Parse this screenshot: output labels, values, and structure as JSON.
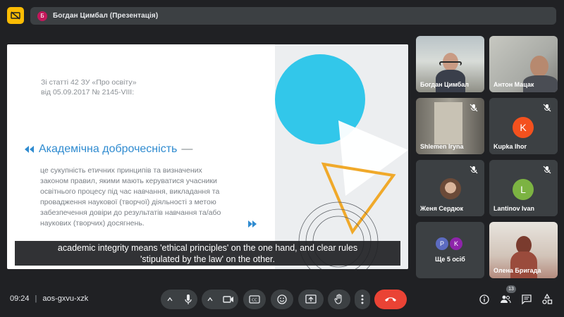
{
  "top_bar": {
    "presenter_initial": "Б",
    "presenter_label": "Богдан Цимбал (Презентація)"
  },
  "slide": {
    "source_line1": "Зі статті 42 ЗУ «Про освіту»",
    "source_line2": "від 05.09.2017 № 2145-VIII:",
    "heading": "Академічна доброчесність",
    "heading_dash": "—",
    "body_lines": [
      "це сукупність етичних принципів та визначених",
      "законом правил, якими мають керуватися учасники",
      "освітнього процесу під час навчання, викладання та",
      "провадження наукової (творчої) діяльності з метою",
      "забезпечення довіри до результатів навчання та/або",
      "наукових (творчих) досягнень."
    ],
    "colors": {
      "heading": "#2f8bd0",
      "circle": "#32c7ea",
      "triangle": "#f0a92a"
    }
  },
  "caption": {
    "line1": "academic integrity means 'ethical principles' on the one hand, and clear rules",
    "line2": "'stipulated by the law' on the other."
  },
  "participants": [
    {
      "name": "Богдан Цимбал",
      "camera": true,
      "muted": false
    },
    {
      "name": "Антон Мацак",
      "camera": true,
      "muted": false
    },
    {
      "name": "Shlemen Iryna",
      "camera": true,
      "muted": true
    },
    {
      "name": "Kupka Ihor",
      "initial": "K",
      "color": "#f4511e",
      "muted": true
    },
    {
      "name": "Женя Сердюк",
      "camera": true,
      "muted": true
    },
    {
      "name": "Lantinov Ivan",
      "initial": "L",
      "color": "#7cb342",
      "muted": true
    },
    {
      "name": "Олена Бригада",
      "camera": true,
      "muted": false
    }
  ],
  "more": {
    "avatars": [
      {
        "initial": "P",
        "color": "#5c6bc0"
      },
      {
        "initial": "K",
        "color": "#8e24aa"
      }
    ],
    "label": "Ще 5 осіб"
  },
  "bottom_bar": {
    "time": "09:24",
    "separator": "|",
    "meeting_code": "aos-gxvu-xzk",
    "participant_count": "13",
    "icons": [
      "chevron-up-icon",
      "mic-icon",
      "chevron-up-icon",
      "camera-icon",
      "captions-icon",
      "emoji-icon",
      "present-icon",
      "hand-icon",
      "more-icon",
      "end-call-icon",
      "info-icon",
      "people-icon",
      "chat-icon",
      "activities-icon"
    ]
  }
}
